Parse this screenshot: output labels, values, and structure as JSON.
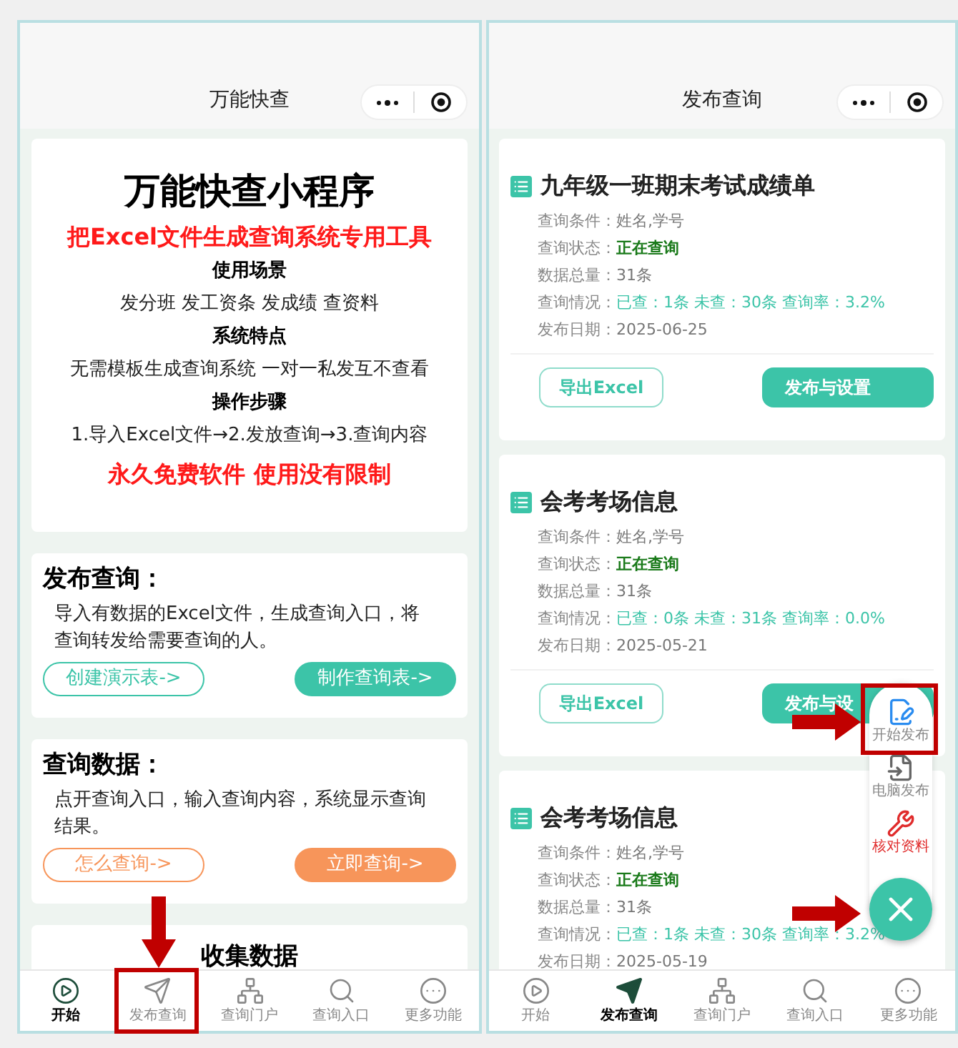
{
  "home_screen": {
    "title": "万能快查",
    "intro": {
      "title": "万能快查小程序",
      "tagline": "把Excel文件生成查询系统专用工具",
      "sections": [
        {
          "heading": "使用场景",
          "text": "发分班 发工资条 发成绩 查资料"
        },
        {
          "heading": "系统特点",
          "text": "无需模板生成查询系统 一对一私发互不查看"
        },
        {
          "heading": "操作步骤",
          "text": "1.导入Excel文件→2.发放查询→3.查询内容"
        }
      ],
      "footer": "永久免费软件 使用没有限制"
    },
    "features": [
      {
        "title": "发布查询：",
        "description": "导入有数据的Excel文件，生成查询入口，将查询转发给需要查询的人。",
        "color": "#3cc4a8",
        "buttons": [
          {
            "label": "创建演示表->",
            "kind": "outline"
          },
          {
            "label": "制作查询表->",
            "kind": "filled"
          }
        ]
      },
      {
        "title": "查询数据：",
        "description": "点开查询入口，输入查询内容，系统显示查询结果。",
        "color": "#f7955a",
        "buttons": [
          {
            "label": "怎么查询->",
            "kind": "outline"
          },
          {
            "label": "立即查询->",
            "kind": "filled"
          }
        ]
      }
    ],
    "next_section": "收集数据",
    "tabs": [
      {
        "label": "开始",
        "kind": "start",
        "selected": true
      },
      {
        "label": "发布查询",
        "kind": "publish",
        "selected": false
      },
      {
        "label": "查询门户",
        "kind": "portal",
        "selected": false
      },
      {
        "label": "查询入口",
        "kind": "search",
        "selected": false
      },
      {
        "label": "更多功能",
        "kind": "more",
        "selected": false
      }
    ]
  },
  "publish_screen": {
    "title": "发布查询",
    "records": [
      {
        "title": "九年级一班期末考试成绩单",
        "fields": [
          {
            "label": "查询条件：",
            "value": "姓名,学号",
            "kind": "plain"
          },
          {
            "label": "查询状态：",
            "value": "正在查询",
            "kind": "status"
          },
          {
            "label": "数据总量：",
            "value": "31条",
            "kind": "plain"
          },
          {
            "label": "查询情况：",
            "value": "已查：1条 未查：30条 查询率：3.2%",
            "kind": "stats"
          },
          {
            "label": "发布日期：",
            "value": "2025-06-25",
            "kind": "plain"
          }
        ],
        "buttons": [
          {
            "label": "导出Excel",
            "kind": "outline"
          },
          {
            "label": "发布与设置",
            "kind": "filled"
          }
        ]
      },
      {
        "title": "会考考场信息",
        "fields": [
          {
            "label": "查询条件：",
            "value": "姓名,学号",
            "kind": "plain"
          },
          {
            "label": "查询状态：",
            "value": "正在查询",
            "kind": "status"
          },
          {
            "label": "数据总量：",
            "value": "31条",
            "kind": "plain"
          },
          {
            "label": "查询情况：",
            "value": "已查：0条 未查：31条 查询率：0.0%",
            "kind": "stats"
          },
          {
            "label": "发布日期：",
            "value": "2025-05-21",
            "kind": "plain"
          }
        ],
        "buttons": [
          {
            "label": "导出Excel",
            "kind": "outline"
          },
          {
            "label": "发布与设",
            "kind": "filled"
          }
        ]
      },
      {
        "title": "会考考场信息",
        "fields": [
          {
            "label": "查询条件：",
            "value": "姓名,学号",
            "kind": "plain"
          },
          {
            "label": "查询状态：",
            "value": "正在查询",
            "kind": "status"
          },
          {
            "label": "数据总量：",
            "value": "31条",
            "kind": "plain"
          },
          {
            "label": "查询情况：",
            "value": "已查：1条 未查：30条 查询率：3.2%",
            "kind": "stats"
          },
          {
            "label": "发布日期：",
            "value": "2025-05-19",
            "kind": "plain"
          }
        ]
      }
    ],
    "fab_menu": [
      {
        "label": "开始发布",
        "kind": "publish",
        "color": "#888888"
      },
      {
        "label": "电脑发布",
        "kind": "computer",
        "color": "#888888"
      },
      {
        "label": "核对资料",
        "kind": "check",
        "color": "#e02b2b"
      }
    ],
    "tabs": [
      {
        "label": "开始",
        "kind": "start",
        "selected": false
      },
      {
        "label": "发布查询",
        "kind": "publish",
        "selected": true
      },
      {
        "label": "查询门户",
        "kind": "portal",
        "selected": false
      },
      {
        "label": "查询入口",
        "kind": "search",
        "selected": false
      },
      {
        "label": "更多功能",
        "kind": "more",
        "selected": false
      }
    ]
  }
}
